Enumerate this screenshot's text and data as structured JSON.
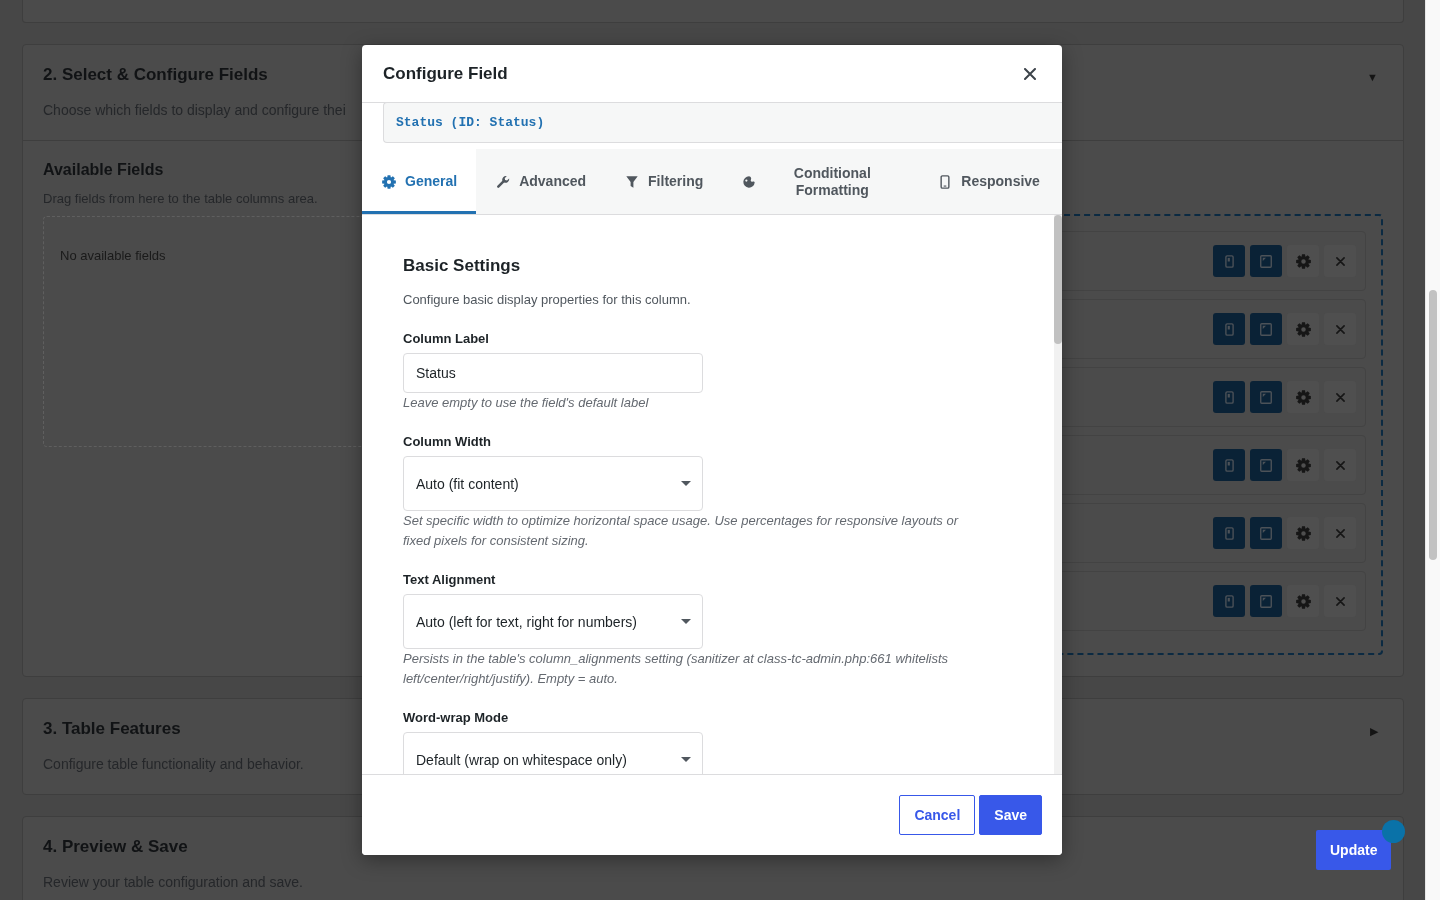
{
  "sections": [
    {
      "title": "2. Select & Configure Fields",
      "description": "Choose which fields to display and configure thei",
      "toggle": "▼",
      "available_fields": {
        "title": "Available Fields",
        "hint": "Drag fields from here to the table columns area.",
        "empty_text": "No available fields"
      },
      "table_columns": {
        "rows": [
          {
            "show_mobile": true,
            "show_tablet": true
          },
          {
            "show_mobile": true,
            "show_tablet": true
          },
          {
            "show_mobile": true,
            "show_tablet": true
          },
          {
            "show_mobile": true,
            "show_tablet": true
          },
          {
            "show_mobile": true,
            "show_tablet": true
          },
          {
            "show_mobile": true,
            "show_tablet": true
          }
        ]
      }
    },
    {
      "title": "3. Table Features",
      "description": "Configure table functionality and behavior.",
      "toggle": "▶"
    },
    {
      "title": "4. Preview & Save",
      "description": "Review your table configuration and save."
    }
  ],
  "update_button": {
    "label": "Update"
  },
  "modal": {
    "title": "Configure Field",
    "field_id": "Status (ID: Status)",
    "tabs": [
      {
        "kind": "general",
        "label": "General",
        "selected": true
      },
      {
        "kind": "advanced",
        "label": "Advanced",
        "selected": false
      },
      {
        "kind": "filtering",
        "label": "Filtering",
        "selected": false
      },
      {
        "kind": "conditional",
        "label": "Conditional Formatting",
        "selected": false
      },
      {
        "kind": "responsive",
        "label": "Responsive",
        "selected": false
      }
    ],
    "section": {
      "title": "Basic Settings",
      "description": "Configure basic display properties for this column."
    },
    "fields": [
      {
        "kind": "text",
        "label": "Column Label",
        "value": "Status",
        "help": "Leave empty to use the field's default label"
      },
      {
        "kind": "select",
        "label": "Column Width",
        "value": "Auto (fit content)",
        "help": "Set specific width to optimize horizontal space usage. Use percentages for responsive layouts or fixed pixels for consistent sizing."
      },
      {
        "kind": "select",
        "label": "Text Alignment",
        "value": "Auto (left for text, right for numbers)",
        "help": "Persists in the table's column_alignments setting (sanitizer at class-tc-admin.php:661 whitelists left/center/right/justify). Empty = auto."
      },
      {
        "kind": "select",
        "label": "Word-wrap Mode",
        "value": "Default (wrap on whitespace only)"
      }
    ],
    "buttons": [
      {
        "kind": "secondary",
        "label": "Cancel"
      },
      {
        "kind": "primary",
        "label": "Save"
      }
    ]
  }
}
